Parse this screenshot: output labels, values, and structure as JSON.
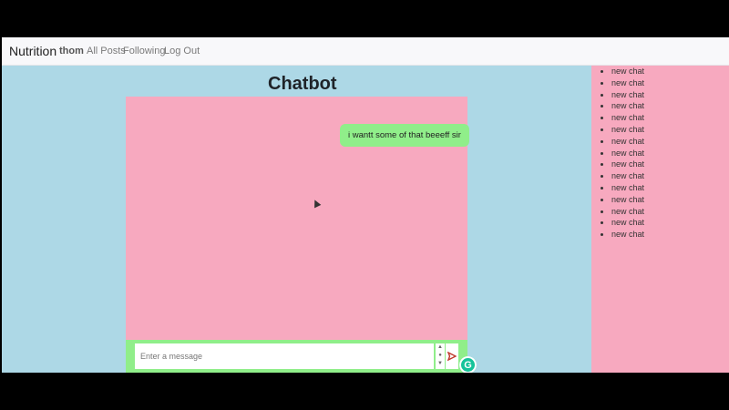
{
  "navbar": {
    "brand": "Nutrition",
    "username": "thom",
    "links": [
      "All Posts",
      "Following",
      "Log Out"
    ]
  },
  "page_title": "Chatbot",
  "messages": [
    {
      "sender": "user",
      "text": "i wantt some of that beeeff sir"
    }
  ],
  "input": {
    "placeholder": "Enter a message",
    "value": ""
  },
  "sidebar": {
    "items": [
      "new chat",
      "new chat",
      "new chat",
      "new chat",
      "new chat",
      "new chat",
      "new chat",
      "new chat",
      "new chat",
      "new chat",
      "new chat",
      "new chat",
      "new chat",
      "new chat",
      "new chat"
    ]
  },
  "colors": {
    "page_background": "#add8e6",
    "chat_background": "#f7a9bf",
    "bubble_user": "#90ee8a",
    "input_bar": "#90ee8a",
    "sidebar_background": "#f7a9bf"
  },
  "icons": [
    "send-icon",
    "grammarly-icon",
    "stepper-icon"
  ]
}
